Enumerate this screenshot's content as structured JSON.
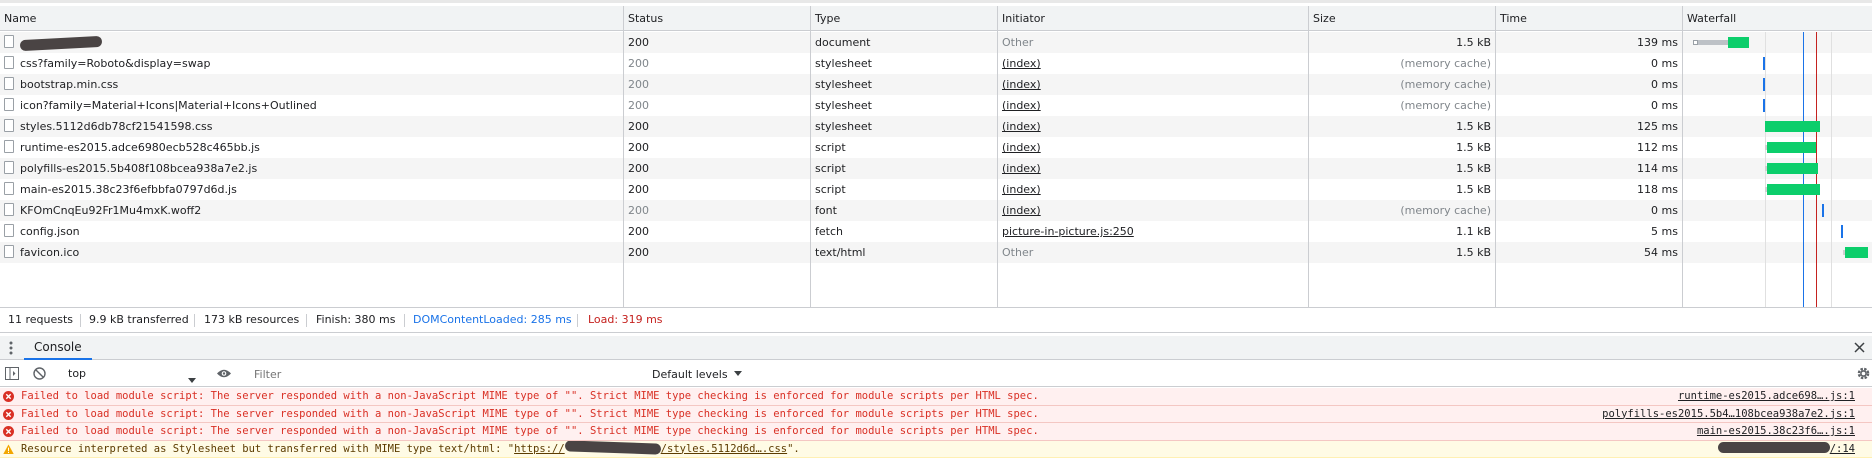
{
  "columns": {
    "name": "Name",
    "status": "Status",
    "type": "Type",
    "initiator": "Initiator",
    "size": "Size",
    "time": "Time",
    "waterfall": "Waterfall"
  },
  "requests": [
    {
      "name": "",
      "status": "200",
      "type": "document",
      "initiator": "Other",
      "size": "1.5 kB",
      "time": "139 ms",
      "waterfall": {
        "start": 0.02,
        "wait": 0.17,
        "end": 0.27,
        "color": "#0cce6b"
      }
    },
    {
      "name": "css?family=Roboto&display=swap",
      "status": "200",
      "type": "stylesheet",
      "initiator": "(index)",
      "size": "(memory cache)",
      "time": "0 ms",
      "waterfall": {
        "start": 0.34,
        "wait": 0.34,
        "end": 0.35,
        "color": "#1a73e8"
      }
    },
    {
      "name": "bootstrap.min.css",
      "status": "200",
      "type": "stylesheet",
      "initiator": "(index)",
      "size": "(memory cache)",
      "time": "0 ms",
      "waterfall": {
        "start": 0.34,
        "wait": 0.34,
        "end": 0.35,
        "color": "#1a73e8"
      }
    },
    {
      "name": "icon?family=Material+Icons|Material+Icons+Outlined",
      "status": "200",
      "type": "stylesheet",
      "initiator": "(index)",
      "size": "(memory cache)",
      "time": "0 ms",
      "waterfall": {
        "start": 0.34,
        "wait": 0.34,
        "end": 0.35,
        "color": "#1a73e8"
      }
    },
    {
      "name": "styles.5112d6db78cf21541598.css",
      "status": "200",
      "type": "stylesheet",
      "initiator": "(index)",
      "size": "1.5 kB",
      "time": "125 ms",
      "waterfall": {
        "start": 0.35,
        "wait": 0.35,
        "end": 0.61,
        "color": "#0cce6b"
      }
    },
    {
      "name": "runtime-es2015.adce6980ecb528c465bb.js",
      "status": "200",
      "type": "script",
      "initiator": "(index)",
      "size": "1.5 kB",
      "time": "112 ms",
      "waterfall": {
        "start": 0.35,
        "wait": 0.36,
        "end": 0.59,
        "color": "#0cce6b"
      }
    },
    {
      "name": "polyfills-es2015.5b408f108bcea938a7e2.js",
      "status": "200",
      "type": "script",
      "initiator": "(index)",
      "size": "1.5 kB",
      "time": "114 ms",
      "waterfall": {
        "start": 0.35,
        "wait": 0.36,
        "end": 0.6,
        "color": "#0cce6b"
      }
    },
    {
      "name": "main-es2015.38c23f6efbbfa0797d6d.js",
      "status": "200",
      "type": "script",
      "initiator": "(index)",
      "size": "1.5 kB",
      "time": "118 ms",
      "waterfall": {
        "start": 0.35,
        "wait": 0.36,
        "end": 0.61,
        "color": "#0cce6b"
      }
    },
    {
      "name": "KFOmCnqEu92Fr1Mu4mxK.woff2",
      "status": "200",
      "type": "font",
      "initiator": "(index)",
      "size": "(memory cache)",
      "time": "0 ms",
      "waterfall": {
        "start": 0.62,
        "wait": 0.62,
        "end": 0.63,
        "color": "#1a73e8"
      }
    },
    {
      "name": "config.json",
      "status": "200",
      "type": "fetch",
      "initiator": "picture-in-picture.js:250",
      "size": "1.1 kB",
      "time": "5 ms",
      "waterfall": {
        "start": 0.71,
        "wait": 0.71,
        "end": 0.72,
        "color": "#1a73e8"
      }
    },
    {
      "name": "favicon.ico",
      "status": "200",
      "type": "text/html",
      "initiator": "Other",
      "size": "1.5 kB",
      "time": "54 ms",
      "waterfall": {
        "start": 0.72,
        "wait": 0.73,
        "end": 0.84,
        "color": "#0cce6b"
      }
    }
  ],
  "summary": {
    "requests": "11 requests",
    "transferred": "9.9 kB transferred",
    "resources": "173 kB resources",
    "finish": "Finish: 380 ms",
    "dom_content_loaded": "DOMContentLoaded: 285 ms",
    "load": "Load: 319 ms"
  },
  "console": {
    "tab_label": "Console",
    "context": "top",
    "filter_placeholder": "Filter",
    "levels": "Default levels",
    "messages": [
      {
        "level": "error",
        "text": "Failed to load module script: The server responded with a non-JavaScript MIME type of \"\". Strict MIME type checking is enforced for module scripts per HTML spec.",
        "source": "runtime-es2015.adce698….js:1"
      },
      {
        "level": "error",
        "text": "Failed to load module script: The server responded with a non-JavaScript MIME type of \"\". Strict MIME type checking is enforced for module scripts per HTML spec.",
        "source": "polyfills-es2015.5b4…108bcea938a7e2.js:1"
      },
      {
        "level": "error",
        "text": "Failed to load module script: The server responded with a non-JavaScript MIME type of \"\". Strict MIME type checking is enforced for module scripts per HTML spec.",
        "source": "main-es2015.38c23f6….js:1"
      },
      {
        "level": "warning",
        "text_prefix": "Resource interpreted as Stylesheet but transferred with MIME type text/html: \"",
        "url_start": "https://",
        "url_end": "/styles.5112d6d….css",
        "text_suffix": "\".",
        "source": "/:14"
      }
    ]
  },
  "colors": {
    "dom_content_loaded": "#1a73e8",
    "load": "#c5221f",
    "error_text": "#d93025",
    "bar_green": "#0cce6b",
    "bar_blue": "#1a73e8"
  }
}
